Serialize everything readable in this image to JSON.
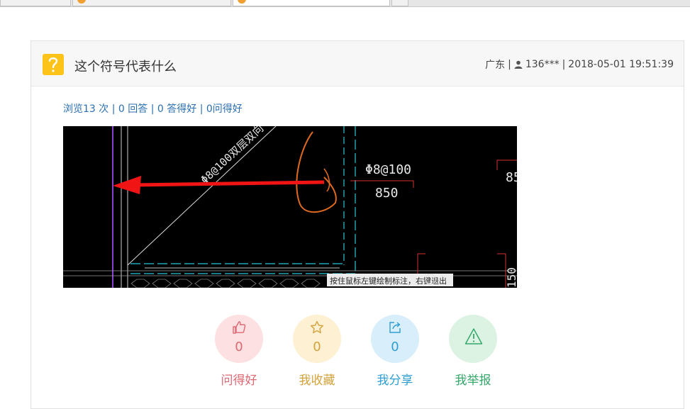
{
  "question": {
    "title": "这个符号代表什么",
    "location": "广东",
    "user": "136***",
    "datetime": "2018-05-01 19:51:39"
  },
  "stats": {
    "views": "浏览13 次",
    "answers": "0 回答",
    "good_answers": "0 答得好",
    "good_questions": "0问得好"
  },
  "cad_image": {
    "slab_label": "Φ8@100双层双向",
    "rebar_label": "Φ8@100",
    "length_label": "850",
    "right_label": "85",
    "right_bottom_label": "150",
    "status_hint": "按住鼠标左键绘制标注，右键退出"
  },
  "actions": [
    {
      "label": "问得好",
      "count": "0",
      "icon": "thumbs-up-icon",
      "color": "#e06873",
      "bg": "#fde0e2"
    },
    {
      "label": "我收藏",
      "count": "0",
      "icon": "star-icon",
      "color": "#d4a23b",
      "bg": "#fdf0d3"
    },
    {
      "label": "我分享",
      "count": "0",
      "icon": "share-icon",
      "color": "#2f9fd3",
      "bg": "#d8eefa"
    },
    {
      "label": "我举报",
      "count": "",
      "icon": "warning-icon",
      "color": "#35a86a",
      "bg": "#dcf3e3"
    }
  ]
}
